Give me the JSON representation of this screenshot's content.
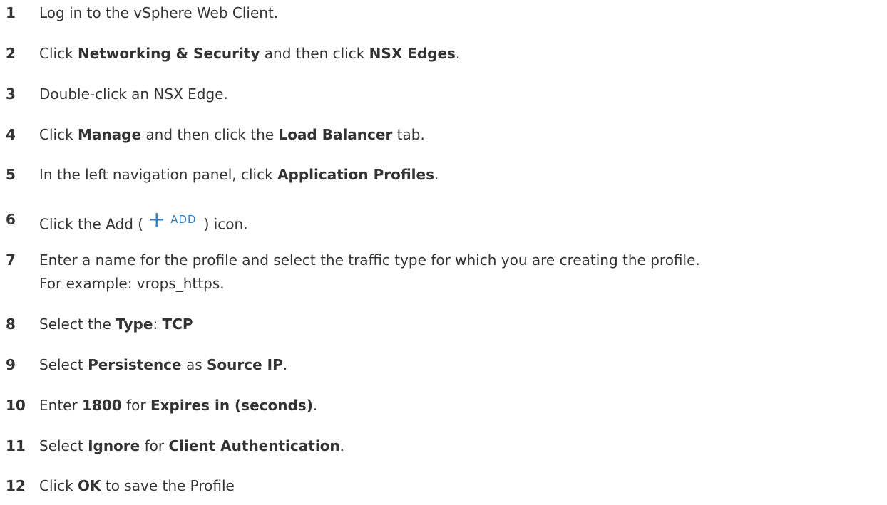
{
  "steps": [
    {
      "num": "1",
      "parts": [
        {
          "t": "Log in to the vSphere Web Client."
        }
      ]
    },
    {
      "num": "2",
      "parts": [
        {
          "t": "Click "
        },
        {
          "t": "Networking & Security",
          "b": true
        },
        {
          "t": " and then click "
        },
        {
          "t": "NSX Edges",
          "b": true
        },
        {
          "t": "."
        }
      ]
    },
    {
      "num": "3",
      "parts": [
        {
          "t": "Double-click an NSX Edge."
        }
      ]
    },
    {
      "num": "4",
      "parts": [
        {
          "t": "Click "
        },
        {
          "t": "Manage",
          "b": true
        },
        {
          "t": " and then click the "
        },
        {
          "t": "Load Balancer",
          "b": true
        },
        {
          "t": " tab."
        }
      ]
    },
    {
      "num": "5",
      "parts": [
        {
          "t": "In the left navigation panel, click "
        },
        {
          "t": "Application Profiles",
          "b": true
        },
        {
          "t": "."
        }
      ]
    },
    {
      "num": "6",
      "parts": [
        {
          "t": "Click the Add ("
        },
        {
          "icon": "add-icon",
          "plus": "+",
          "label": "ADD"
        },
        {
          "t": ") icon."
        }
      ]
    },
    {
      "num": "7",
      "parts": [
        {
          "t": "Enter a name for the profile and select the traffic type for which you are creating the profile."
        }
      ],
      "line2": "For example: vrops_https."
    },
    {
      "num": "8",
      "parts": [
        {
          "t": "Select the "
        },
        {
          "t": "Type",
          "b": true
        },
        {
          "t": ": "
        },
        {
          "t": "TCP",
          "b": true
        }
      ]
    },
    {
      "num": "9",
      "parts": [
        {
          "t": "Select "
        },
        {
          "t": "Persistence",
          "b": true
        },
        {
          "t": " as "
        },
        {
          "t": "Source IP",
          "b": true
        },
        {
          "t": "."
        }
      ]
    },
    {
      "num": "10",
      "parts": [
        {
          "t": "Enter "
        },
        {
          "t": "1800",
          "b": true
        },
        {
          "t": " for "
        },
        {
          "t": "Expires in (seconds)",
          "b": true
        },
        {
          "t": "."
        }
      ]
    },
    {
      "num": "11",
      "parts": [
        {
          "t": "Select "
        },
        {
          "t": "Ignore",
          "b": true
        },
        {
          "t": " for "
        },
        {
          "t": "Client Authentication",
          "b": true
        },
        {
          "t": "."
        }
      ]
    },
    {
      "num": "12",
      "parts": [
        {
          "t": "Click "
        },
        {
          "t": "OK",
          "b": true
        },
        {
          "t": " to save the Profile"
        }
      ]
    }
  ],
  "colors": {
    "text": "#333333",
    "icon": "#2f7fc1"
  }
}
